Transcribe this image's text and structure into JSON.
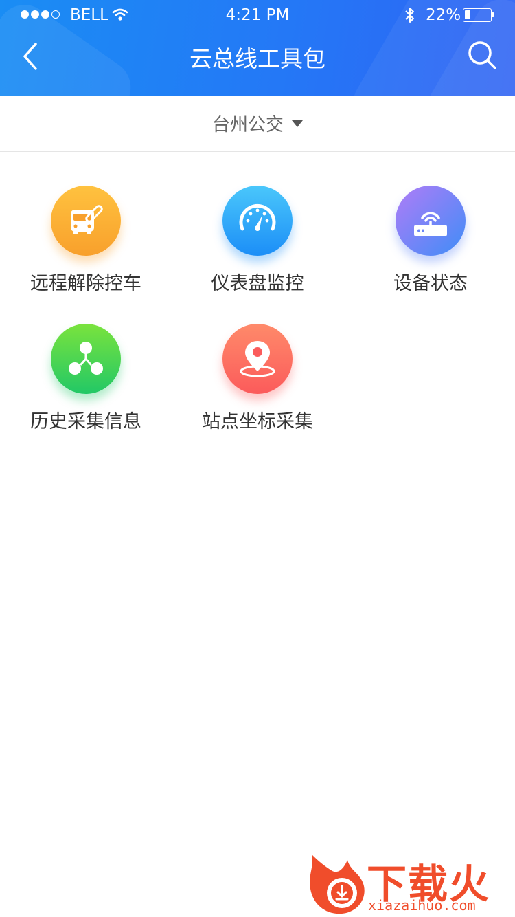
{
  "status_bar": {
    "carrier": "BELL",
    "time": "4:21 PM",
    "battery": "22%",
    "battery_level": 0.22,
    "signal_bars": 3,
    "signal_total": 4
  },
  "header": {
    "title": "云总线工具包",
    "back_icon": "chevron-left-icon",
    "search_icon": "search-icon"
  },
  "selector": {
    "value": "台州公交"
  },
  "tools": [
    {
      "label": "远程解除控车",
      "icon": "bus-link-icon",
      "color": "#f8a02c"
    },
    {
      "label": "仪表盘监控",
      "icon": "speedometer-icon",
      "color": "#1c8ef7"
    },
    {
      "label": "设备状态",
      "icon": "router-icon",
      "color": "#6b86f7"
    },
    {
      "label": "历史采集信息",
      "icon": "cluster-icon",
      "color": "#22c866"
    },
    {
      "label": "站点坐标采集",
      "icon": "location-pin-icon",
      "color": "#fb5b5b"
    }
  ],
  "watermark": {
    "title": "下载火",
    "url": "xiazaihuo.com"
  }
}
